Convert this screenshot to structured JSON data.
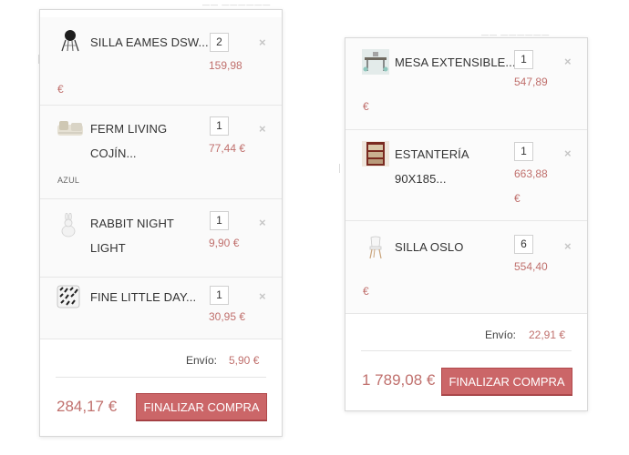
{
  "left_cart": {
    "items": [
      {
        "name": "SILLA EAMES DSW...",
        "quantity": "2",
        "price": "159,98",
        "currency": "€",
        "thumbnail_icon": "black-chair-thumbnail"
      },
      {
        "name_line1": "FERM LIVING",
        "name_line2": "COJÍN...",
        "variant": "AZUL",
        "quantity": "1",
        "price": "77,44 €",
        "thumbnail_icon": "cushion-thumbnail"
      },
      {
        "name_line1": "RABBIT NIGHT",
        "name_line2": "LIGHT",
        "quantity": "1",
        "price": "9,90 €",
        "thumbnail_icon": "rabbit-lamp-thumbnail"
      },
      {
        "name": "FINE LITTLE DAY...",
        "quantity": "1",
        "price": "30,95 €",
        "thumbnail_icon": "patterned-pillow-thumbnail"
      }
    ],
    "remove_symbol": "×",
    "shipping_label": "Envío:",
    "shipping_value": "5,90 €",
    "total": "284,17 €",
    "checkout_label": "FINALIZAR COMPRA"
  },
  "right_cart": {
    "items": [
      {
        "name": "MESA EXTENSIBLE...",
        "quantity": "1",
        "price": "547,89",
        "currency": "€",
        "thumbnail_icon": "extendable-table-thumbnail"
      },
      {
        "name_line1": "ESTANTERÍA",
        "name_line2": "90X185...",
        "quantity": "1",
        "price": "663,88",
        "currency": "€",
        "thumbnail_icon": "shelf-thumbnail"
      },
      {
        "name": "SILLA OSLO",
        "quantity": "6",
        "price": "554,40",
        "currency": "€",
        "thumbnail_icon": "white-chair-thumbnail"
      }
    ],
    "remove_symbol": "×",
    "shipping_label": "Envío:",
    "shipping_value": "22,91 €",
    "total": "1 789,08 €",
    "checkout_label": "FINALIZAR COMPRA"
  },
  "colors": {
    "price_accent": "#c0706d",
    "button_bg": "#cb6668",
    "button_border": "#b0484b"
  }
}
